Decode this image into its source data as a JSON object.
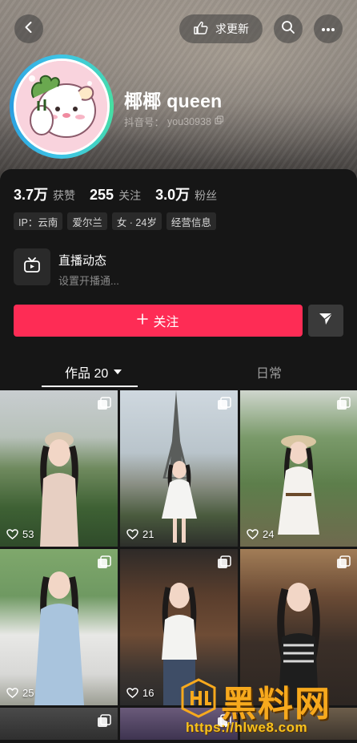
{
  "header": {
    "update_request_label": "求更新"
  },
  "profile": {
    "name": "椰椰 queen",
    "uid_label": "抖音号：",
    "uid": "you30938"
  },
  "stats": [
    {
      "num": "3.7万",
      "label": "获赞"
    },
    {
      "num": "255",
      "label": "关注"
    },
    {
      "num": "3.0万",
      "label": "粉丝"
    }
  ],
  "tags": [
    "IP：云南",
    "爱尔兰",
    "女 · 24岁",
    "经营信息"
  ],
  "live": {
    "title": "直播动态",
    "subtitle": "设置开播通..."
  },
  "actions": {
    "follow_label": "关注"
  },
  "tabs": {
    "works_label": "作品 20",
    "daily_label": "日常"
  },
  "grid": [
    {
      "likes": "53"
    },
    {
      "likes": "21"
    },
    {
      "likes": "24"
    },
    {
      "likes": "25"
    },
    {
      "likes": "16"
    },
    {
      "likes": ""
    }
  ],
  "watermark": {
    "brand": "黑料网",
    "url": "https://hlwe8.com"
  },
  "colors": {
    "accent": "#fe2c55",
    "background": "#161616",
    "watermark": "#f7a91d"
  }
}
